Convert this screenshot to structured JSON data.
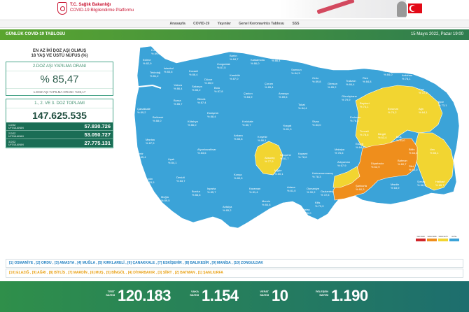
{
  "header": {
    "brand_line1": "T.C. Sağlık Bakanlığı",
    "brand_line2": "COVID-19 Bilgilendirme Platformu"
  },
  "nav": {
    "items": [
      "Anasayfa",
      "COVID-19",
      "Yayınlar",
      "Genel Koronavirüs Tablosu",
      "SSS"
    ]
  },
  "titlebar": {
    "title": "GÜNLÜK COVID-19 TABLOSU",
    "date": "15 Mayıs 2022, Pazar 19:00"
  },
  "left_panel": {
    "header_line1": "EN AZ İKİ DOZ AŞI OLMUŞ",
    "header_line2": "18 YAŞ VE ÜSTÜ NÜFUS (%)",
    "dose2_title": "2.DOZ AŞI YAPILMA ORANI",
    "dose2_value": "% 85,47",
    "dose1_note": "1.DOZ AŞI YAPILMA ORANI: %93,17",
    "total_title": "1., 2. VE 3. DOZ TOPLAMI",
    "total_value": "147.625.535",
    "doses": [
      {
        "label_line1": "1.DOZ",
        "label_line2": "UYGULANAN",
        "value": "57.830.726"
      },
      {
        "label_line1": "2.DOZ",
        "label_line2": "UYGULANAN",
        "value": "53.050.727"
      },
      {
        "label_line1": "3.DOZ",
        "label_line2": "UYGULANAN",
        "value": "27.775.131"
      }
    ]
  },
  "colors": {
    "high": "#3ba3d8",
    "mid": "#f2d531",
    "low": "#ef8e1c",
    "lowest": "#d0262a",
    "border": "#ffffff"
  },
  "legend": {
    "ranges": [
      {
        "label": "%0-%60",
        "color": "#d0262a"
      },
      {
        "label": "%60-%65",
        "color": "#ef8e1c"
      },
      {
        "label": "%65-%75",
        "color": "#f2d531"
      },
      {
        "label": "%75+",
        "color": "#3ba3d8"
      }
    ]
  },
  "lists": {
    "top_line": "[1] OSMANİYE , [2] ORDU , [3] AMASYA , [4] MUĞLA , [5] KIRKLARELİ , [6] ÇANAKKALE , [7] ESKİŞEHİR , [8] BALIKESİR , [9] MANİSA , [10] ZONGULDAK",
    "bottom_line": "[10] ELAZIĞ , [9] AĞRI , [8] BİTLİS , [7] MARDİN , [6] MUŞ , [5] BİNGÖL , [4] DİYARBAKIR , [3] SİİRT , [2] BATMAN , [1] ŞANLIURFA"
  },
  "stats": [
    {
      "label_line1": "TEST",
      "label_line2": "SAYISI",
      "value": "120.183"
    },
    {
      "label_line1": "VAKA",
      "label_line2": "SAYISI",
      "value": "1.154"
    },
    {
      "label_line1": "VEFAT",
      "label_line2": "SAYISI",
      "value": "10"
    },
    {
      "label_line1": "İYİLEŞEN",
      "label_line2": "SAYISI",
      "value": "1.190"
    }
  ],
  "map_cities": [
    {
      "name": "Edirne",
      "pct": "% 82,9"
    },
    {
      "name": "Kırklareli",
      "pct": "% 89,4"
    },
    {
      "name": "Tekirdağ",
      "pct": "% 81,2"
    },
    {
      "name": "İstanbul",
      "pct": "% 83,6"
    },
    {
      "name": "Kocaeli",
      "pct": "% 86,4"
    },
    {
      "name": "Zonguldak",
      "pct": "% 87,5"
    },
    {
      "name": "Bartın",
      "pct": "% 84,7"
    },
    {
      "name": "Kastamonu",
      "pct": "% 86,0"
    },
    {
      "name": "Sinop",
      "pct": "% 86,4"
    },
    {
      "name": "Samsun",
      "pct": "% 84,3"
    },
    {
      "name": "Ordu",
      "pct": "% 89,8"
    },
    {
      "name": "Giresun",
      "pct": "% 85,2"
    },
    {
      "name": "Trabzon",
      "pct": "% 84,4"
    },
    {
      "name": "Rize",
      "pct": "% 84,8"
    },
    {
      "name": "Artvin",
      "pct": "% 84,0"
    },
    {
      "name": "Ardahan",
      "pct": "% 78,1"
    },
    {
      "name": "Kars",
      "pct": "% 72,1"
    },
    {
      "name": "Erzurum",
      "pct": "% 74,2"
    },
    {
      "name": "Ağrı",
      "pct": "% 64,1"
    },
    {
      "name": "Iğdır",
      "pct": "% 73,1"
    },
    {
      "name": "Bayburt",
      "pct": "% 74,1"
    },
    {
      "name": "Gümüşhane",
      "pct": "% 79,9"
    },
    {
      "name": "Erzincan",
      "pct": "% 78,3"
    },
    {
      "name": "Tunceli",
      "pct": "% 78,6"
    },
    {
      "name": "Bingöl",
      "pct": "% 63,4"
    },
    {
      "name": "Muş",
      "pct": "% 63,0"
    },
    {
      "name": "Van",
      "pct": "% 65,1"
    },
    {
      "name": "Bitlis",
      "pct": "% 64,8"
    },
    {
      "name": "Elazığ",
      "pct": "% 64,6"
    },
    {
      "name": "Malatya",
      "pct": "% 76,6"
    },
    {
      "name": "Diyarbakır",
      "pct": "% 62,9"
    },
    {
      "name": "Batman",
      "pct": "% 60,7"
    },
    {
      "name": "Siirt",
      "pct": "% 61,0"
    },
    {
      "name": "Şırnak",
      "pct": "% 66,5"
    },
    {
      "name": "Hakkari",
      "pct": "% 65,7"
    },
    {
      "name": "Mardin",
      "pct": "% 63,9"
    },
    {
      "name": "Şanlıurfa",
      "pct": "% 60,3"
    },
    {
      "name": "Adıyaman",
      "pct": "% 67,9"
    },
    {
      "name": "Gaziantep",
      "pct": "% 72,5"
    },
    {
      "name": "Kilis",
      "pct": "% 73,9"
    },
    {
      "name": "Hatay",
      "pct": "% 76,0"
    },
    {
      "name": "Osmaniye",
      "pct": "% 90,2"
    },
    {
      "name": "Adana",
      "pct": "% 81,0"
    },
    {
      "name": "Mersin",
      "pct": "% 84,8"
    },
    {
      "name": "Kahramanmaraş",
      "pct": "% 78,3"
    },
    {
      "name": "Antalya",
      "pct": "% 85,2"
    },
    {
      "name": "Isparta",
      "pct": "% 85,7"
    },
    {
      "name": "Burdur",
      "pct": "% 86,6"
    },
    {
      "name": "Muğla",
      "pct": "% 89,5"
    },
    {
      "name": "Aydın",
      "pct": "% 83,5"
    },
    {
      "name": "Denizli",
      "pct": "% 83,7"
    },
    {
      "name": "İzmir",
      "pct": "% 85,4"
    },
    {
      "name": "Manisa",
      "pct": "% 87,9"
    },
    {
      "name": "Balıkesir",
      "pct": "% 88,0"
    },
    {
      "name": "Çanakkale",
      "pct": "% 89,2"
    },
    {
      "name": "Bursa",
      "pct": "% 85,7"
    },
    {
      "name": "Bilecik",
      "pct": "% 87,4"
    },
    {
      "name": "Eskişehir",
      "pct": "% 88,4"
    },
    {
      "name": "Kütahya",
      "pct": "% 86,0"
    },
    {
      "name": "Uşak",
      "pct": "% 84,1"
    },
    {
      "name": "Afyonkarahisar",
      "pct": "% 83,6"
    },
    {
      "name": "Konya",
      "pct": "% 80,5"
    },
    {
      "name": "Karaman",
      "pct": "% 81,4"
    },
    {
      "name": "Aksaray",
      "pct": "% 77,9"
    },
    {
      "name": "Niğde",
      "pct": "% 80,1"
    },
    {
      "name": "Nevşehir",
      "pct": "% 81,7"
    },
    {
      "name": "Kayseri",
      "pct": "% 78,6"
    },
    {
      "name": "Sivas",
      "pct": "% 83,0"
    },
    {
      "name": "Tokat",
      "pct": "% 84,4"
    },
    {
      "name": "Amasya",
      "pct": "% 89,6"
    },
    {
      "name": "Çorum",
      "pct": "% 85,4"
    },
    {
      "name": "Yozgat",
      "pct": "% 81,0"
    },
    {
      "name": "Kırşehir",
      "pct": "% 86,1"
    },
    {
      "name": "Kırıkkale",
      "pct": "% 80,7"
    },
    {
      "name": "Ankara",
      "pct": "% 85,8"
    },
    {
      "name": "Çankırı",
      "pct": "% 84,9"
    },
    {
      "name": "Bolu",
      "pct": "% 87,8"
    },
    {
      "name": "Düzce",
      "pct": "% 85,0"
    },
    {
      "name": "Sakarya",
      "pct": "% 85,2"
    },
    {
      "name": "Yalova",
      "pct": "% 86,4"
    },
    {
      "name": "Karabük",
      "pct": "% 87,0"
    }
  ]
}
